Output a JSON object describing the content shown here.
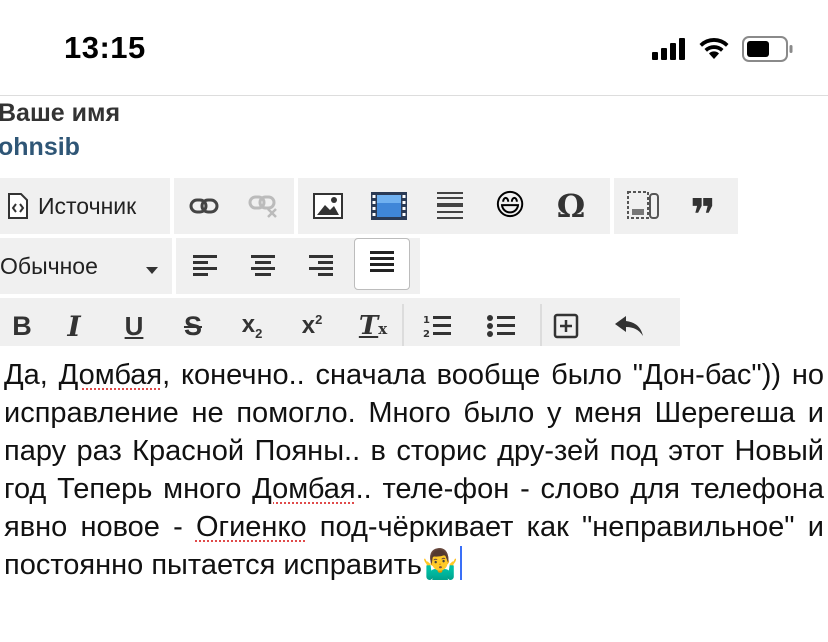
{
  "status": {
    "time": "13:15"
  },
  "author": {
    "label": "Ваше имя",
    "username": "ohnsib"
  },
  "toolbar": {
    "source_label": "Источник",
    "format_select": "Обычное",
    "icons": {
      "source": "source-icon",
      "link": "link-icon",
      "unlink": "unlink-icon",
      "image": "image-icon",
      "video": "video-icon",
      "hr": "horizontal-rule-icon",
      "smiley": "smiley-icon",
      "special_char": "omega-icon",
      "iframe": "iframe-icon",
      "blockquote": "blockquote-icon",
      "align_left": "align-left-icon",
      "align_center": "align-center-icon",
      "align_right": "align-right-icon",
      "align_justify": "align-justify-icon",
      "bold": "bold-icon",
      "italic": "italic-icon",
      "underline": "underline-icon",
      "strike": "strikethrough-icon",
      "subscript": "subscript-icon",
      "superscript": "superscript-icon",
      "remove_format": "remove-format-icon",
      "numbered_list": "numbered-list-icon",
      "bulleted_list": "bulleted-list-icon",
      "table": "table-icon",
      "undo": "undo-icon"
    },
    "glyphs": {
      "omega": "Ω",
      "quote": "❞",
      "smiley": "😄"
    }
  },
  "editor": {
    "text_1": "Да, ",
    "word_1": "Домбая",
    "text_2": ", конечно.. сначала вообще было \"Дон-бас\")) но исправление не помогло. Много было у меня Шерегеша и пару раз Красной Пояны.. в сторис дру-зей под этот Новый год Теперь много ",
    "word_2": "Домбая",
    "text_3": ".. теле-фон - слово для телефона явно новое - ",
    "word_3": "Огиенко",
    "text_4": " под-чёркивает как \"неправильное\" и постоянно пытается исправить",
    "emoji": "🤷‍♂️"
  },
  "colors": {
    "toolbar_bg": "#f0f0f0",
    "author_name": "#333333",
    "username": "#2f5676",
    "caret": "#3a6ff7",
    "spell_underline": "#e04a4a"
  }
}
